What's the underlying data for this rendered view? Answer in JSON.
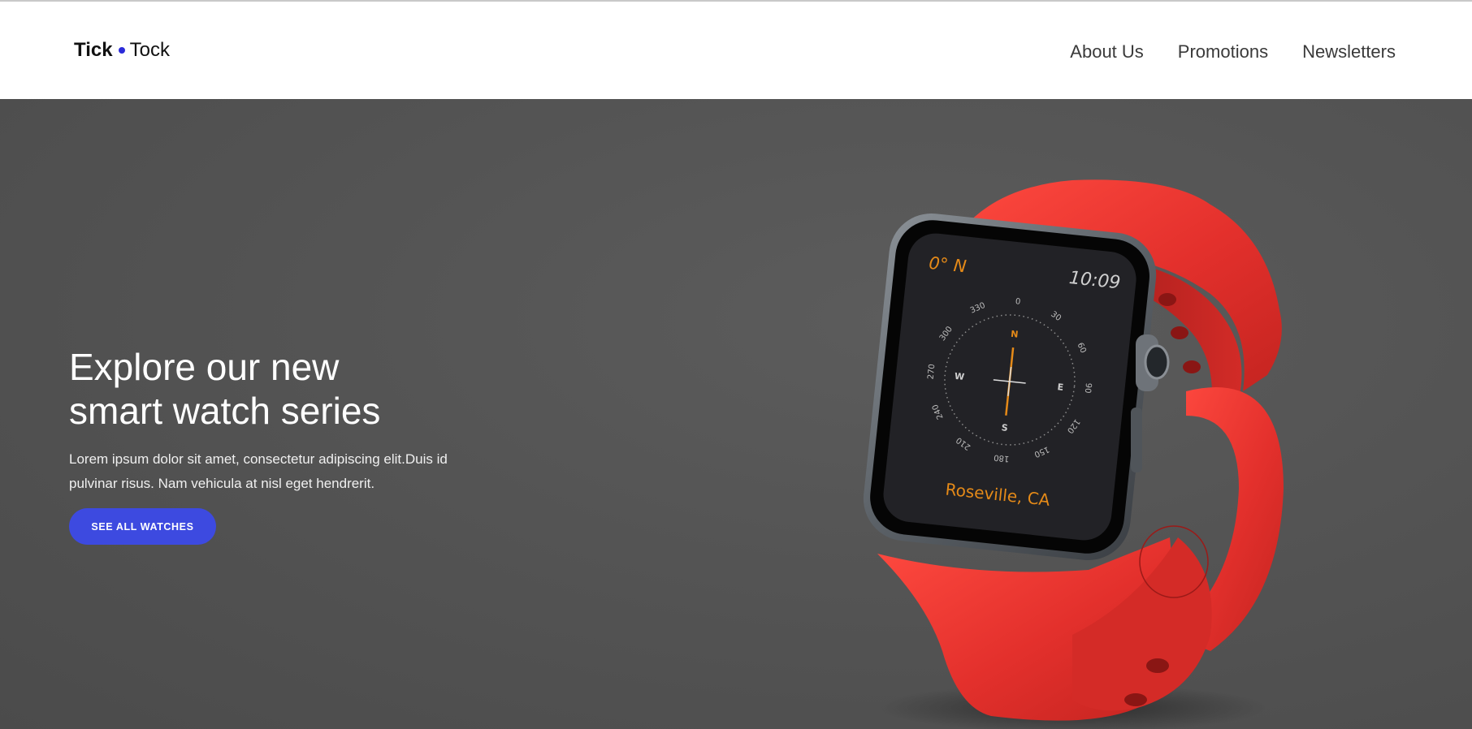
{
  "brand": {
    "part1": "Tick",
    "part2": "Tock",
    "dot_color": "#2b2bd9"
  },
  "nav": {
    "items": [
      "About Us",
      "Promotions",
      "Newsletters"
    ]
  },
  "hero": {
    "title_line1": "Explore our new",
    "title_line2": "smart watch series",
    "description": "Lorem ipsum dolor sit amet, consectetur adipiscing elit.Duis id pulvinar risus. Nam vehicula at nisl eget hendrerit.",
    "cta_label": "SEE ALL WATCHES",
    "cta_color": "#3d4ae0"
  },
  "watch": {
    "heading": "0° N",
    "time": "10:09",
    "location": "Roseville, CA",
    "band_color": "#e8332f",
    "degree_marks": [
      "0",
      "30",
      "60",
      "90",
      "120",
      "150",
      "180",
      "210",
      "240",
      "270",
      "300",
      "330"
    ],
    "cardinals": {
      "north": "N",
      "east": "E",
      "south": "S",
      "west": "W"
    }
  }
}
